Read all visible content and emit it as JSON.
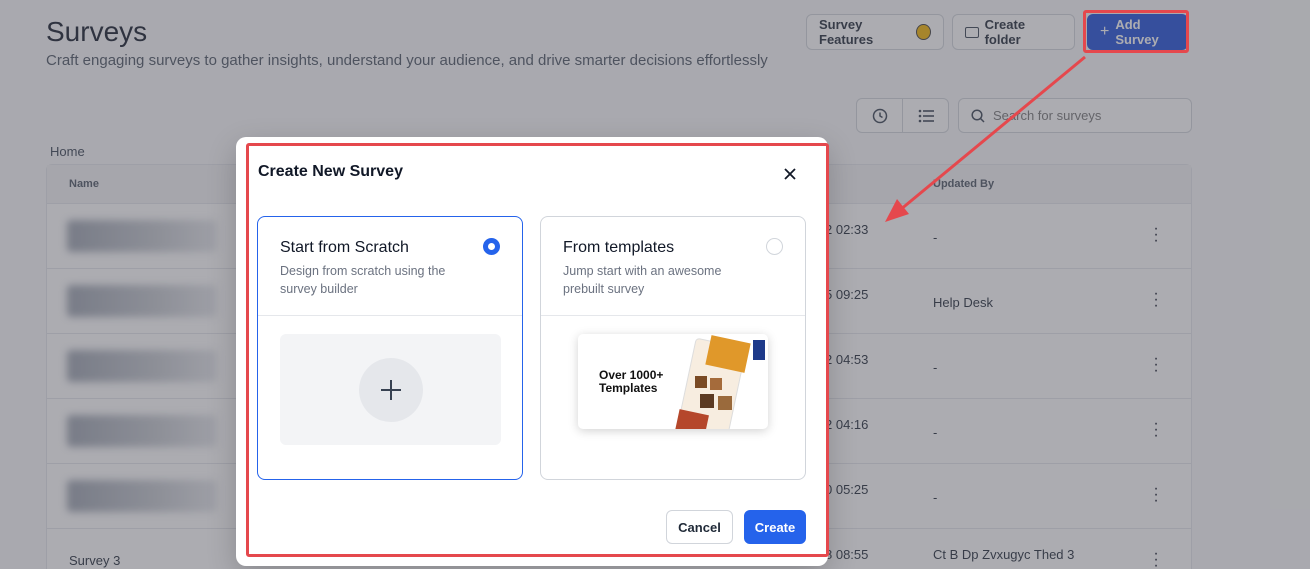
{
  "page": {
    "title": "Surveys",
    "subtitle": "Craft engaging surveys to gather insights, understand your audience, and drive smarter decisions effortlessly",
    "breadcrumb": "Home"
  },
  "header_buttons": {
    "features": "Survey Features",
    "create_folder": "Create folder",
    "add_survey": "Add Survey"
  },
  "search": {
    "placeholder": "Search for surveys"
  },
  "table": {
    "columns": {
      "name": "Name",
      "updated_by": "Updated By"
    },
    "rows": [
      {
        "date": "2 02:33",
        "updated_by": "-"
      },
      {
        "date": "5 09:25",
        "updated_by": "Help Desk"
      },
      {
        "date": "2 04:53",
        "updated_by": "-"
      },
      {
        "date": "2 04:16",
        "updated_by": "-"
      },
      {
        "date": "0 05:25",
        "updated_by": "-"
      },
      {
        "name": "Survey 3",
        "date": "8 08:55",
        "updated_by": "Ct B Dp Zvxugyc Thed 3"
      }
    ]
  },
  "modal": {
    "title": "Create New Survey",
    "options": [
      {
        "title": "Start from Scratch",
        "description": "Design from scratch using the survey builder",
        "selected": true
      },
      {
        "title": "From templates",
        "description": "Jump start with an awesome prebuilt survey",
        "selected": false,
        "preview_text": "Over 1000+ Templates"
      }
    ],
    "cancel_label": "Cancel",
    "create_label": "Create"
  },
  "colors": {
    "primary": "#2563eb",
    "highlight": "#e5484d"
  }
}
